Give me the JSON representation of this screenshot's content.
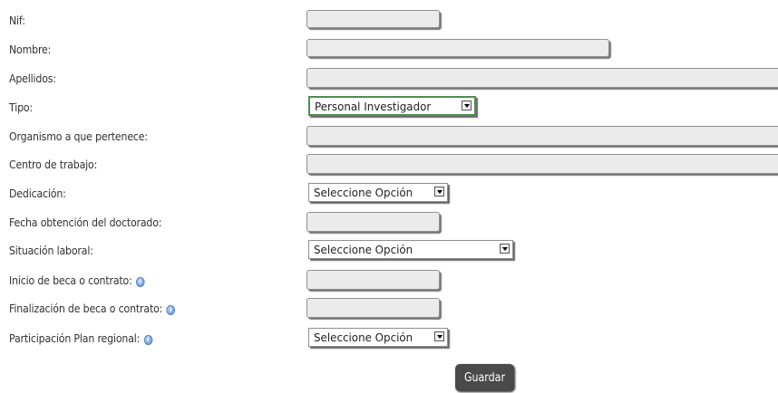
{
  "form": {
    "fields": [
      {
        "label": "Nif:",
        "value": ""
      },
      {
        "label": "Nombre:",
        "value": ""
      },
      {
        "label": "Apellidos:",
        "value": ""
      },
      {
        "label": "Tipo:",
        "value": "Personal Investigador"
      },
      {
        "label": "Organismo a que pertenece:",
        "value": ""
      },
      {
        "label": "Centro de trabajo:",
        "value": ""
      },
      {
        "label": "Dedicación:",
        "value": "Seleccione Opción"
      },
      {
        "label": "Fecha obtención del doctorado:",
        "value": ""
      },
      {
        "label": "Situación laboral:",
        "value": "Seleccione Opción"
      },
      {
        "label": "Inicio de beca o contrato:",
        "value": ""
      },
      {
        "label": "Finalización de beca o contrato:",
        "value": ""
      },
      {
        "label": "Participación Plan regional:",
        "value": "Seleccione Opción"
      }
    ],
    "help_icon": "info-icon",
    "submit_label": "Guardar"
  }
}
